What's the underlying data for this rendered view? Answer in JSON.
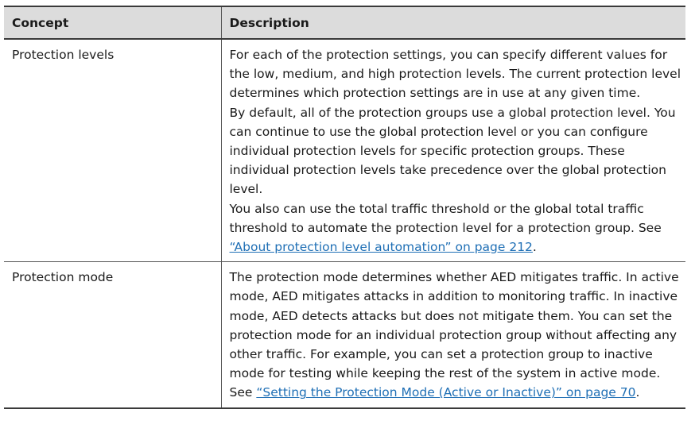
{
  "table": {
    "headers": {
      "concept": "Concept",
      "description": "Description"
    },
    "rows": [
      {
        "concept": "Protection levels",
        "paragraphs": [
          {
            "text": "For each of the protection settings, you can specify different values for the low, medium, and high protection levels. The current protection level determines which protection settings are in use at any given time."
          },
          {
            "text": "By default, all of the protection groups use a global protection level. You can continue to use the global protection level or you can configure individual protection levels for specific protection groups. These individual protection levels take precedence over the global protection level."
          },
          {
            "text": "You also can use the total traffic threshold or the global total traffic threshold to automate the protection level for a protection group. See ",
            "link": "“About protection level automation” on page 212",
            "after": "."
          }
        ]
      },
      {
        "concept": "Protection mode",
        "paragraphs": [
          {
            "text": "The protection mode determines whether AED mitigates traffic. In active mode, AED mitigates attacks in addition to monitoring traffic. In inactive mode, AED detects attacks but does not mitigate them. You can set the protection mode for an individual protection group without affecting any other traffic. For example, you can set a protection group to inactive mode for testing while keeping the rest of the system in active mode. See ",
            "link": "“Setting the Protection Mode (Active or Inactive)” on page 70",
            "after": "."
          }
        ]
      }
    ]
  },
  "colors": {
    "header_background": "#dcdcdc",
    "rule": "#3a3a3a",
    "link": "#1f6fb5"
  }
}
